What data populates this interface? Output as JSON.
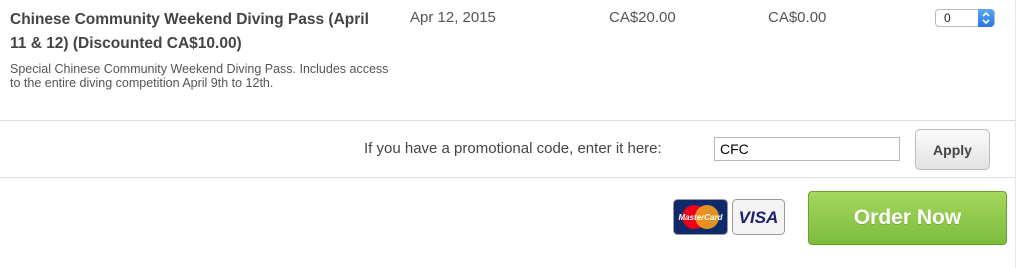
{
  "ticket": {
    "name": "Chinese Community Weekend Diving Pass (April 11 & 12) (Discounted CA$10.00)",
    "description": "Special Chinese Community Weekend Diving Pass. Includes access to the entire diving competition April 9th to 12th.",
    "sales_end": "Apr 12, 2015",
    "price": "CA$20.00",
    "fee": "CA$0.00",
    "quantity": "0"
  },
  "promo": {
    "label": "If you have a promotional code, enter it here:",
    "code_value": "CFC",
    "apply_label": "Apply"
  },
  "payment": {
    "mastercard_text": "MasterCard",
    "visa_text": "VISA",
    "order_label": "Order Now"
  },
  "colors": {
    "order_button": "#8cc84b",
    "select_arrows": "#3b86e8",
    "visa_blue": "#1a1f71",
    "mastercard_red": "#eb001b",
    "mastercard_orange": "#f79e1b"
  },
  "icons": {
    "select": "up-down-chevron-icon",
    "mastercard": "mastercard-logo",
    "visa": "visa-logo"
  }
}
